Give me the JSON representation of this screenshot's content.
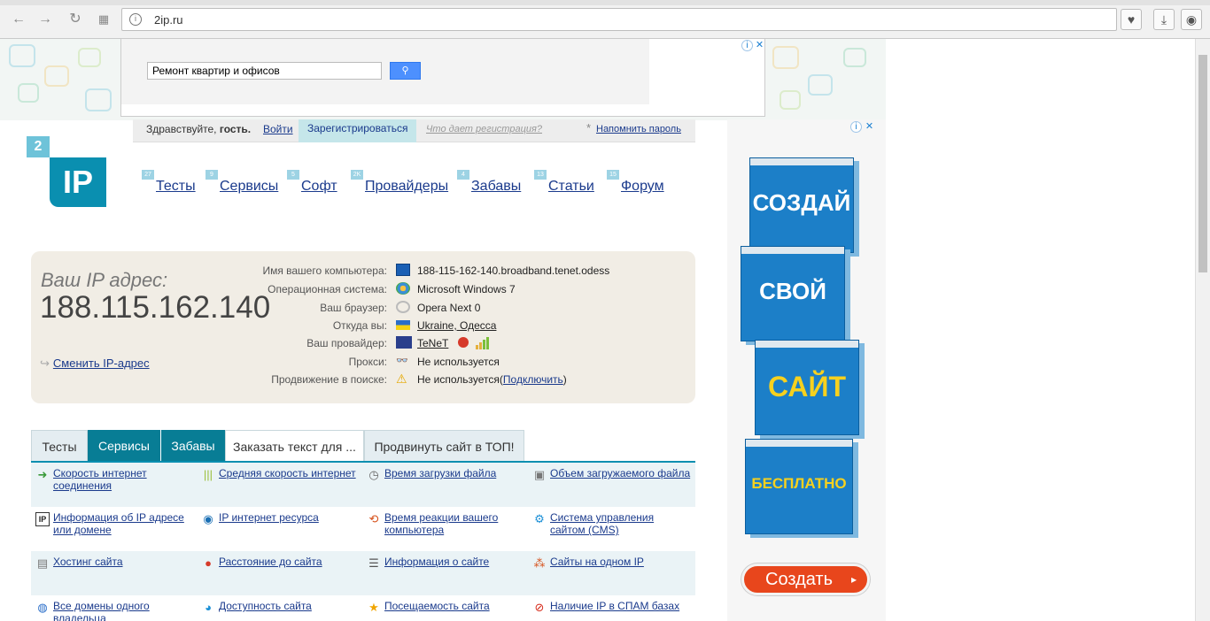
{
  "browser": {
    "url": "2ip.ru"
  },
  "top_ad": {
    "search_value": "Ремонт квартир и офисов",
    "info_glyph": "i",
    "close_glyph": "✕"
  },
  "userbar": {
    "hello": "Здравствуйте, ",
    "guest": "гость.",
    "login": "Войти",
    "register": "Зарегистрироваться",
    "why": "Что дает регистрация?",
    "star": "*",
    "remind": "Напомнить пароль"
  },
  "logo": {
    "two": "2",
    "ip": "IP"
  },
  "nav": [
    {
      "label": "Тесты",
      "count": "27"
    },
    {
      "label": "Сервисы",
      "count": "9"
    },
    {
      "label": "Софт",
      "count": "5"
    },
    {
      "label": "Провайдеры",
      "count": "2K"
    },
    {
      "label": "Забавы",
      "count": "4"
    },
    {
      "label": "Статьи",
      "count": "13"
    },
    {
      "label": "Форум",
      "count": "15"
    }
  ],
  "ipinfo": {
    "label": "Ваш IP адрес:",
    "ip": "188.115.162.140",
    "change": "Сменить IP-адрес",
    "rows": [
      {
        "key": "Имя вашего компьютера:",
        "value": "188-115-162-140.broadband.tenet.odess"
      },
      {
        "key": "Операционная система:",
        "value": "Microsoft Windows 7"
      },
      {
        "key": "Ваш браузер:",
        "value": "Opera Next 0"
      },
      {
        "key": "Откуда вы:",
        "value": "Ukraine, Одесса"
      },
      {
        "key": "Ваш провайдер:",
        "value": "TeNeT"
      },
      {
        "key": "Прокси:",
        "value": "Не используется"
      },
      {
        "key": "Продвижение в поиске:",
        "value": "Не используется(",
        "link": "Подключить",
        "tail": ")"
      }
    ]
  },
  "tabs": [
    "Тесты",
    "Сервисы",
    "Забавы",
    "Заказать текст для ...",
    "Продвинуть сайт в ТОП!"
  ],
  "services": [
    "Скорость интернет соединения",
    "Средняя скорость интернет",
    "Время загрузки файла",
    "Объем загружаемого файла",
    "Информация об IP адресе или домене",
    "IP интернет ресурса",
    "Время реакции вашего компьютера",
    "Система управления сайтом (CMS)",
    "Хостинг сайта",
    "Расстояние до сайта",
    "Информация о сайте",
    "Сайты на одном IP",
    "Все домены одного владельца",
    "Доступность сайта",
    "Посещаемость сайта",
    "Наличие IP в СПАМ базах"
  ],
  "right_ad": {
    "words": [
      "СОЗДАЙ",
      "СВОЙ",
      "САЙТ",
      "БЕСПЛАТНО"
    ],
    "button": "Создать"
  }
}
